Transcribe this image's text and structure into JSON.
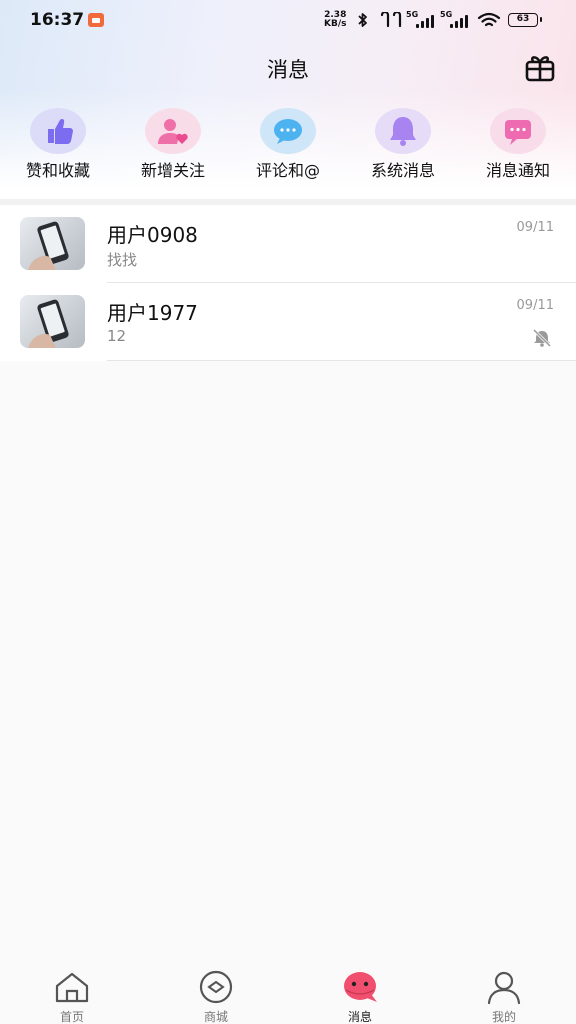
{
  "status_bar": {
    "time": "16:37",
    "net_speed_value": "2.38",
    "net_speed_unit": "KB/s",
    "sim1_label": "5G",
    "sim2_label": "5G",
    "battery": "63"
  },
  "header": {
    "title": "消息"
  },
  "categories": [
    {
      "label": "赞和收藏",
      "icon": "thumbs-up-icon",
      "color": "#7c6cf0",
      "bg": "#dcdcf8"
    },
    {
      "label": "新增关注",
      "icon": "user-heart-icon",
      "color": "#ef6fa8",
      "bg": "#f8dde8"
    },
    {
      "label": "评论和@",
      "icon": "comment-bubble-icon",
      "color": "#4cb3f0",
      "bg": "#cfe6f8"
    },
    {
      "label": "系统消息",
      "icon": "bell-icon",
      "color": "#a884f0",
      "bg": "#e6dcf8"
    },
    {
      "label": "消息通知",
      "icon": "message-square-icon",
      "color": "#ee6bb2",
      "bg": "#f8dcea"
    }
  ],
  "conversations": [
    {
      "name": "用户0908",
      "preview": "找找",
      "date": "09/11",
      "muted": false
    },
    {
      "name": "用户1977",
      "preview": "12",
      "date": "09/11",
      "muted": true
    }
  ],
  "bottom_nav": [
    {
      "label": "首页",
      "icon": "home-icon",
      "active": false
    },
    {
      "label": "商城",
      "icon": "mall-icon",
      "active": false
    },
    {
      "label": "消息",
      "icon": "message-face-icon",
      "active": true
    },
    {
      "label": "我的",
      "icon": "profile-icon",
      "active": false
    }
  ],
  "colors": {
    "accent_nav": "#f0506e",
    "text_primary": "#111111",
    "text_secondary": "#888888"
  }
}
